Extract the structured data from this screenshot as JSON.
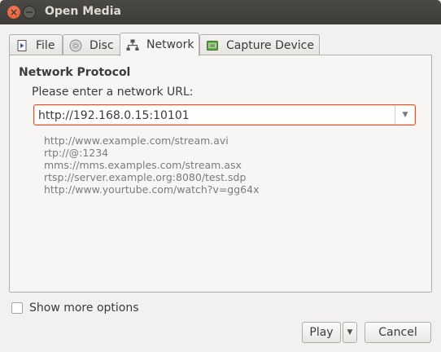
{
  "window": {
    "title": "Open Media"
  },
  "tabs": [
    {
      "label": "File",
      "mnemonic": "F",
      "icon": "file-icon"
    },
    {
      "label": "Disc",
      "mnemonic": "D",
      "icon": "disc-icon"
    },
    {
      "label": "Network",
      "mnemonic": "N",
      "icon": "network-icon",
      "active": true
    },
    {
      "label": "Capture Device",
      "mnemonic": "D",
      "icon": "capture-device-icon"
    }
  ],
  "network": {
    "section_title": "Network Protocol",
    "prompt": "Please enter a network URL:",
    "url_value": "http://192.168.0.15:10101",
    "examples": [
      "http://www.example.com/stream.avi",
      "rtp://@:1234",
      "mms://mms.examples.com/stream.asx",
      "rtsp://server.example.org:8080/test.sdp",
      "http://www.yourtube.com/watch?v=gg64x"
    ]
  },
  "options": {
    "show_more_label": "Show more options",
    "show_more_checked": false
  },
  "buttons": {
    "play": "Play",
    "cancel": "Cancel"
  },
  "colors": {
    "accent": "#e95420",
    "titlebar": "#3c3b37",
    "close_button": "#e4572e"
  }
}
